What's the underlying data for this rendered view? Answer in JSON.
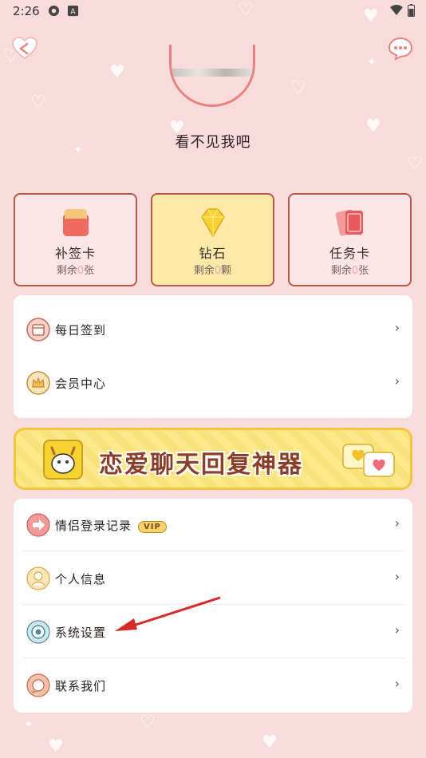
{
  "status": {
    "time": "2:26"
  },
  "profile": {
    "nickname": "看不见我吧"
  },
  "cards": [
    {
      "title": "补签卡",
      "sub_prefix": "剩余",
      "count": "0",
      "unit": "张",
      "icon": "sign-card-icon"
    },
    {
      "title": "钻石",
      "sub_prefix": "剩余",
      "count": "0",
      "unit": "颗",
      "icon": "diamond-icon"
    },
    {
      "title": "任务卡",
      "sub_prefix": "剩余",
      "count": "0",
      "unit": "张",
      "icon": "task-card-icon"
    }
  ],
  "menu1": [
    {
      "label": "每日签到",
      "icon": "calendar-icon"
    },
    {
      "label": "会员中心",
      "icon": "crown-icon"
    }
  ],
  "banner": {
    "text": "恋爱聊天回复神器"
  },
  "menu2": [
    {
      "label": "情侣登录记录",
      "badge": "VIP",
      "icon": "login-record-icon"
    },
    {
      "label": "个人信息",
      "icon": "user-icon"
    },
    {
      "label": "系统设置",
      "icon": "settings-icon"
    },
    {
      "label": "联系我们",
      "icon": "contact-icon"
    }
  ],
  "colors": {
    "background": "#f8dcdc",
    "accent": "#e98282",
    "border": "#b85a4b",
    "diamond_card": "#fde9a8"
  }
}
